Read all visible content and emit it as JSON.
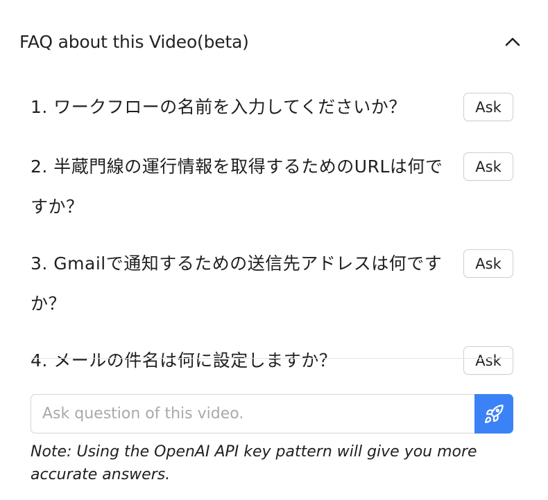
{
  "faq": {
    "title": "FAQ about this Video(beta)",
    "expanded": true,
    "toggle_icon": "chevron-up-icon",
    "items": [
      {
        "question": "1. ワークフローの名前を入力してくださいか？",
        "ask_label": "Ask"
      },
      {
        "question": "2. 半蔵門線の運行情報を取得するためのURLは何ですか？",
        "ask_label": "Ask"
      },
      {
        "question": "3. Gmailで通知するための送信先アドレスは何ですか？",
        "ask_label": "Ask"
      },
      {
        "question": "4. メールの件名は何に設定しますか？",
        "ask_label": "Ask"
      }
    ]
  },
  "ask_form": {
    "value": "",
    "placeholder": "Ask question of this video.",
    "send_icon": "rocket-icon",
    "send_color": "#3b82f6"
  },
  "note": "Note: Using the OpenAI API key pattern will give you more accurate answers."
}
